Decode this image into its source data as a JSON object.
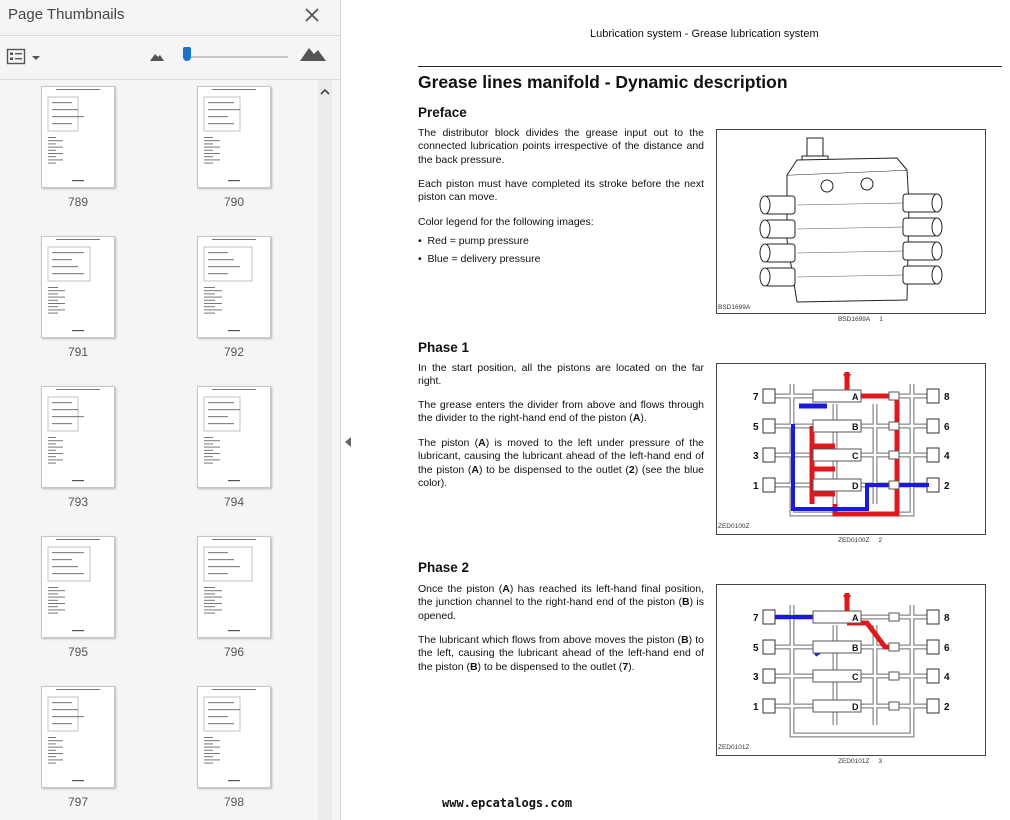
{
  "sidebar": {
    "title": "Page Thumbnails",
    "thumbnails": [
      {
        "page": "789"
      },
      {
        "page": "790"
      },
      {
        "page": "791"
      },
      {
        "page": "792"
      },
      {
        "page": "793"
      },
      {
        "page": "794"
      },
      {
        "page": "795"
      },
      {
        "page": "796"
      },
      {
        "page": "797"
      },
      {
        "page": "798"
      }
    ]
  },
  "document": {
    "running_header": "Lubrication system - Grease lubrication system",
    "title": "Grease lines manifold - Dynamic description",
    "preface": {
      "heading": "Preface",
      "p1": "The distributor block divides the grease input out to the connected lubrication points irrespective of the distance and the back pressure.",
      "p2": "Each piston must have completed its stroke before the next piston can move.",
      "p3": "Color legend for the following images:",
      "bullets": [
        "Red = pump pressure",
        "Blue = delivery pressure"
      ],
      "figure_code": "BSD1699A",
      "caption": "BSD1699A",
      "caption_num": "1"
    },
    "phase1": {
      "heading": "Phase 1",
      "p1": "In the start position, all the pistons are located on the far right.",
      "p2_pre": "The grease enters the divider from above and flows through the divider to the right-hand end of the piston (",
      "p2_b1": "A",
      "p2_post": ").",
      "p3_pre": "The piston (",
      "p3_b1": "A",
      "p3_mid1": ") is moved to the left under pressure of the lubricant, causing the lubricant ahead of the left-hand end of the piston (",
      "p3_b2": "A",
      "p3_mid2": ") to be dispensed to the outlet (",
      "p3_b3": "2",
      "p3_post": ") (see the blue color).",
      "figure_code": "ZED0100Z",
      "caption": "ZED0100Z",
      "caption_num": "2",
      "labels": {
        "left": [
          "7",
          "5",
          "3",
          "1"
        ],
        "right": [
          "8",
          "6",
          "4",
          "2"
        ],
        "pistons": [
          "A",
          "B",
          "C",
          "D"
        ]
      }
    },
    "phase2": {
      "heading": "Phase 2",
      "p1_pre": "Once the piston (",
      "p1_b1": "A",
      "p1_mid": ") has reached its left-hand final position, the junction channel to the right-hand end of the piston (",
      "p1_b2": "B",
      "p1_post": ") is opened.",
      "p2_pre": "The lubricant which flows from above moves the piston (",
      "p2_b1": "B",
      "p2_mid1": ") to the left, causing the lubricant ahead of the left-hand end of the piston (",
      "p2_b2": "B",
      "p2_mid2": ") to be dispensed to the outlet (",
      "p2_b3": "7",
      "p2_post": ").",
      "figure_code": "ZED0101Z",
      "caption": "ZED0101Z",
      "caption_num": "3",
      "labels": {
        "left": [
          "7",
          "5",
          "3",
          "1"
        ],
        "right": [
          "8",
          "6",
          "4",
          "2"
        ],
        "pistons": [
          "A",
          "B",
          "C",
          "D"
        ]
      }
    },
    "footer_url": "www.epcatalogs.com"
  },
  "colors": {
    "pump_pressure": "#e0181e",
    "delivery_pressure": "#1a1adc",
    "accent": "#1a73c8"
  },
  "icons": [
    "close-icon",
    "thumbnail-options-icon",
    "chevron-down-icon",
    "zoom-out-mountain-icon",
    "zoom-in-mountain-icon",
    "scroll-up-arrow-icon",
    "collapse-panel-arrow-icon"
  ]
}
